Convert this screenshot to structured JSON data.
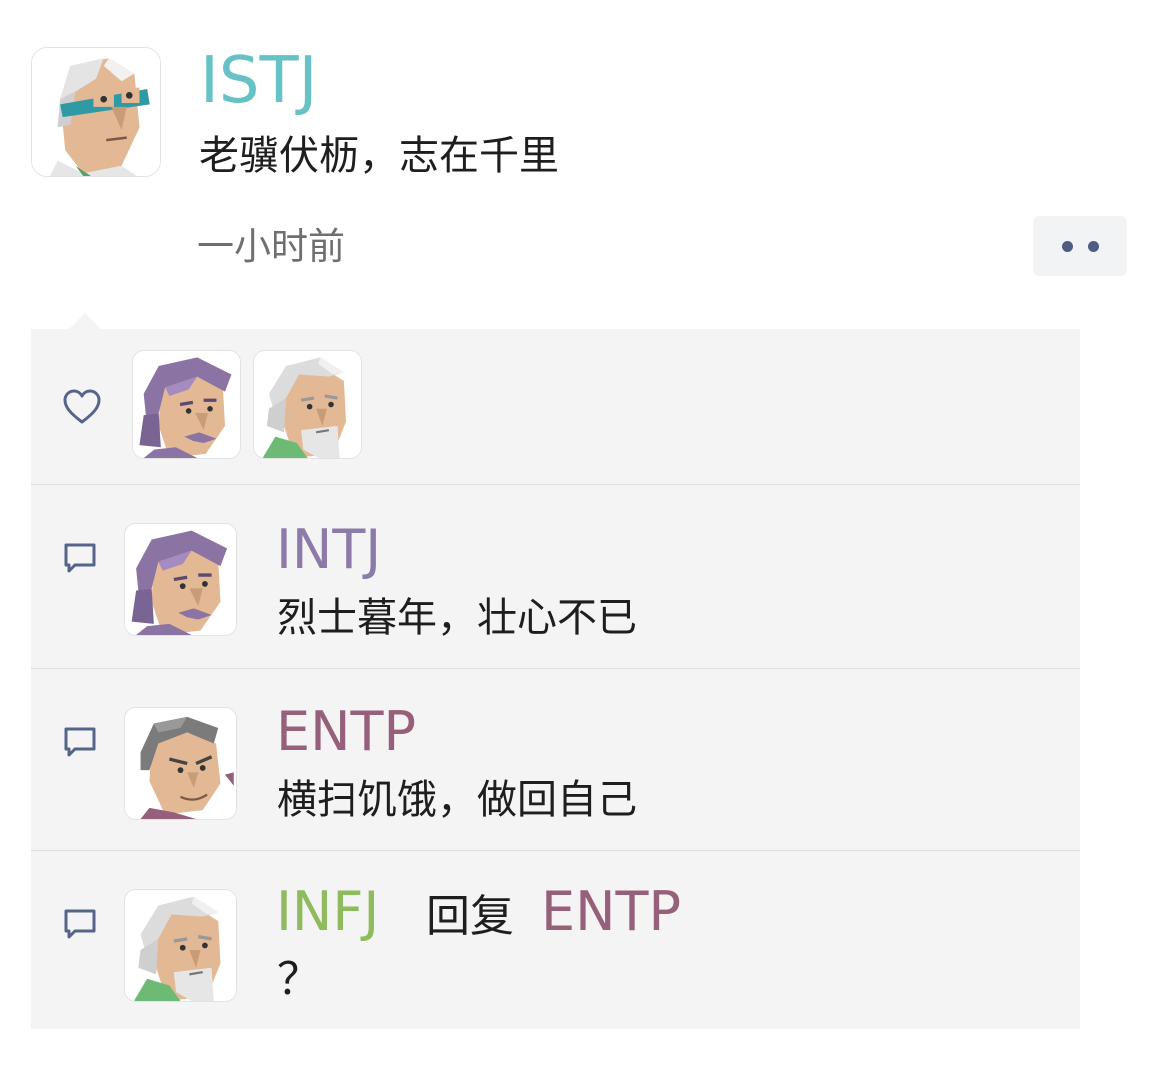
{
  "post": {
    "author": "ISTJ",
    "author_color": "#66c2c4",
    "text": "老骥伏枥，志在千里",
    "time": "一小时前",
    "more_icon": "more-dots-icon"
  },
  "likes": {
    "icon": "heart-icon",
    "avatars": [
      "intj-avatar",
      "infj-avatar"
    ]
  },
  "comments": [
    {
      "author": "INTJ",
      "author_color": "#8c7aa8",
      "text": "烈士暮年，壮心不已",
      "icon": "comment-icon"
    },
    {
      "author": "ENTP",
      "author_color": "#96607a",
      "text": "横扫饥饿，做回自己",
      "icon": "comment-icon"
    },
    {
      "author": "INFJ",
      "author_color": "#8fba5e",
      "reply_word": "回复",
      "reply_to": "ENTP",
      "reply_to_color": "#96607a",
      "text": "？",
      "icon": "comment-icon"
    }
  ]
}
